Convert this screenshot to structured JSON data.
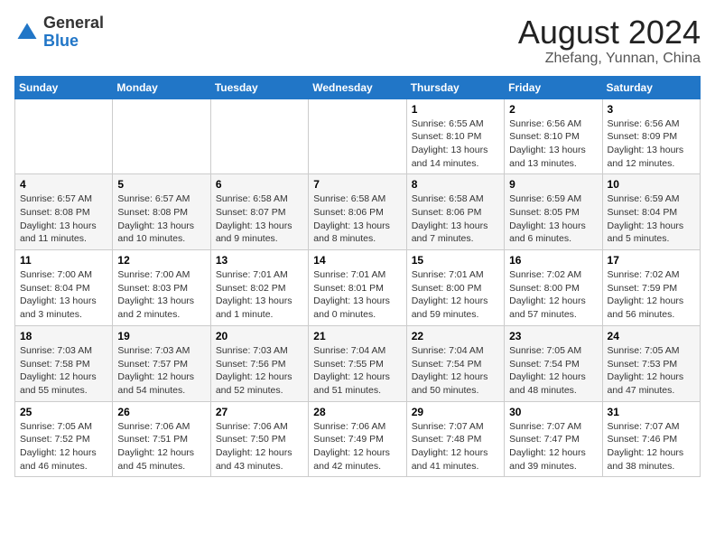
{
  "header": {
    "logo_general": "General",
    "logo_blue": "Blue",
    "month_year": "August 2024",
    "location": "Zhefang, Yunnan, China"
  },
  "weekdays": [
    "Sunday",
    "Monday",
    "Tuesday",
    "Wednesday",
    "Thursday",
    "Friday",
    "Saturday"
  ],
  "weeks": [
    [
      {
        "day": "",
        "info": ""
      },
      {
        "day": "",
        "info": ""
      },
      {
        "day": "",
        "info": ""
      },
      {
        "day": "",
        "info": ""
      },
      {
        "day": "1",
        "info": "Sunrise: 6:55 AM\nSunset: 8:10 PM\nDaylight: 13 hours\nand 14 minutes."
      },
      {
        "day": "2",
        "info": "Sunrise: 6:56 AM\nSunset: 8:10 PM\nDaylight: 13 hours\nand 13 minutes."
      },
      {
        "day": "3",
        "info": "Sunrise: 6:56 AM\nSunset: 8:09 PM\nDaylight: 13 hours\nand 12 minutes."
      }
    ],
    [
      {
        "day": "4",
        "info": "Sunrise: 6:57 AM\nSunset: 8:08 PM\nDaylight: 13 hours\nand 11 minutes."
      },
      {
        "day": "5",
        "info": "Sunrise: 6:57 AM\nSunset: 8:08 PM\nDaylight: 13 hours\nand 10 minutes."
      },
      {
        "day": "6",
        "info": "Sunrise: 6:58 AM\nSunset: 8:07 PM\nDaylight: 13 hours\nand 9 minutes."
      },
      {
        "day": "7",
        "info": "Sunrise: 6:58 AM\nSunset: 8:06 PM\nDaylight: 13 hours\nand 8 minutes."
      },
      {
        "day": "8",
        "info": "Sunrise: 6:58 AM\nSunset: 8:06 PM\nDaylight: 13 hours\nand 7 minutes."
      },
      {
        "day": "9",
        "info": "Sunrise: 6:59 AM\nSunset: 8:05 PM\nDaylight: 13 hours\nand 6 minutes."
      },
      {
        "day": "10",
        "info": "Sunrise: 6:59 AM\nSunset: 8:04 PM\nDaylight: 13 hours\nand 5 minutes."
      }
    ],
    [
      {
        "day": "11",
        "info": "Sunrise: 7:00 AM\nSunset: 8:04 PM\nDaylight: 13 hours\nand 3 minutes."
      },
      {
        "day": "12",
        "info": "Sunrise: 7:00 AM\nSunset: 8:03 PM\nDaylight: 13 hours\nand 2 minutes."
      },
      {
        "day": "13",
        "info": "Sunrise: 7:01 AM\nSunset: 8:02 PM\nDaylight: 13 hours\nand 1 minute."
      },
      {
        "day": "14",
        "info": "Sunrise: 7:01 AM\nSunset: 8:01 PM\nDaylight: 13 hours\nand 0 minutes."
      },
      {
        "day": "15",
        "info": "Sunrise: 7:01 AM\nSunset: 8:00 PM\nDaylight: 12 hours\nand 59 minutes."
      },
      {
        "day": "16",
        "info": "Sunrise: 7:02 AM\nSunset: 8:00 PM\nDaylight: 12 hours\nand 57 minutes."
      },
      {
        "day": "17",
        "info": "Sunrise: 7:02 AM\nSunset: 7:59 PM\nDaylight: 12 hours\nand 56 minutes."
      }
    ],
    [
      {
        "day": "18",
        "info": "Sunrise: 7:03 AM\nSunset: 7:58 PM\nDaylight: 12 hours\nand 55 minutes."
      },
      {
        "day": "19",
        "info": "Sunrise: 7:03 AM\nSunset: 7:57 PM\nDaylight: 12 hours\nand 54 minutes."
      },
      {
        "day": "20",
        "info": "Sunrise: 7:03 AM\nSunset: 7:56 PM\nDaylight: 12 hours\nand 52 minutes."
      },
      {
        "day": "21",
        "info": "Sunrise: 7:04 AM\nSunset: 7:55 PM\nDaylight: 12 hours\nand 51 minutes."
      },
      {
        "day": "22",
        "info": "Sunrise: 7:04 AM\nSunset: 7:54 PM\nDaylight: 12 hours\nand 50 minutes."
      },
      {
        "day": "23",
        "info": "Sunrise: 7:05 AM\nSunset: 7:54 PM\nDaylight: 12 hours\nand 48 minutes."
      },
      {
        "day": "24",
        "info": "Sunrise: 7:05 AM\nSunset: 7:53 PM\nDaylight: 12 hours\nand 47 minutes."
      }
    ],
    [
      {
        "day": "25",
        "info": "Sunrise: 7:05 AM\nSunset: 7:52 PM\nDaylight: 12 hours\nand 46 minutes."
      },
      {
        "day": "26",
        "info": "Sunrise: 7:06 AM\nSunset: 7:51 PM\nDaylight: 12 hours\nand 45 minutes."
      },
      {
        "day": "27",
        "info": "Sunrise: 7:06 AM\nSunset: 7:50 PM\nDaylight: 12 hours\nand 43 minutes."
      },
      {
        "day": "28",
        "info": "Sunrise: 7:06 AM\nSunset: 7:49 PM\nDaylight: 12 hours\nand 42 minutes."
      },
      {
        "day": "29",
        "info": "Sunrise: 7:07 AM\nSunset: 7:48 PM\nDaylight: 12 hours\nand 41 minutes."
      },
      {
        "day": "30",
        "info": "Sunrise: 7:07 AM\nSunset: 7:47 PM\nDaylight: 12 hours\nand 39 minutes."
      },
      {
        "day": "31",
        "info": "Sunrise: 7:07 AM\nSunset: 7:46 PM\nDaylight: 12 hours\nand 38 minutes."
      }
    ]
  ]
}
